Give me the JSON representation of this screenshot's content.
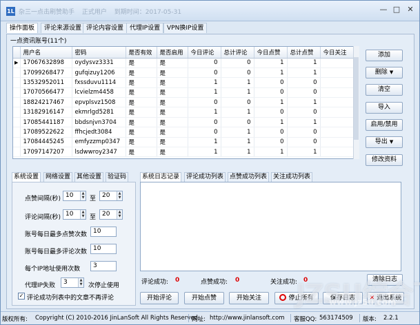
{
  "window": {
    "title_parts": [
      "杂三一点击刷赞助手",
      "正式用户",
      "到期时间：2017-05-31"
    ],
    "app_icon": "1L",
    "controls": {
      "minimize": "—",
      "maximize": "□",
      "close": "✕"
    }
  },
  "menu": {
    "items": [
      {
        "label": "操作面板",
        "active": true
      },
      {
        "label": "评论来源设置"
      },
      {
        "label": "评论内容设置"
      },
      {
        "label": "代理IP设置"
      },
      {
        "label": "VPN换IP设置"
      }
    ]
  },
  "accounts": {
    "group_title": "一点资讯账号(11个)",
    "columns": [
      "用户名",
      "密码",
      "是否有效",
      "是否启用",
      "今日评论",
      "总计评论",
      "今日点赞",
      "总计点赞",
      "今日关注"
    ],
    "rows": [
      [
        "17067632898",
        "oydysvz3331",
        "是",
        "是",
        "0",
        "0",
        "1",
        "1",
        ""
      ],
      [
        "17099268477",
        "gufqizuy1206",
        "是",
        "是",
        "0",
        "0",
        "1",
        "1",
        ""
      ],
      [
        "13532952011",
        "fxssduvu1114",
        "是",
        "是",
        "1",
        "1",
        "0",
        "0",
        ""
      ],
      [
        "17070566477",
        "lcvielzm4458",
        "是",
        "是",
        "1",
        "1",
        "0",
        "0",
        ""
      ],
      [
        "18824217467",
        "epvplsvz1508",
        "是",
        "是",
        "0",
        "0",
        "1",
        "1",
        ""
      ],
      [
        "13182916147",
        "ekmrlgd5281",
        "是",
        "是",
        "1",
        "1",
        "0",
        "0",
        ""
      ],
      [
        "17085441187",
        "bbdsnjvn3704",
        "是",
        "是",
        "0",
        "0",
        "1",
        "1",
        ""
      ],
      [
        "17089522622",
        "ffhcjedt3084",
        "是",
        "是",
        "0",
        "1",
        "0",
        "0",
        ""
      ],
      [
        "17084445245",
        "emfyzzmp0347",
        "是",
        "是",
        "1",
        "1",
        "0",
        "0",
        ""
      ],
      [
        "17097147207",
        "lsdwwroy2347",
        "是",
        "是",
        "1",
        "1",
        "1",
        "1",
        ""
      ]
    ],
    "current_row_marker": "▶"
  },
  "side_buttons": {
    "add": "添加",
    "delete": "删除",
    "clear": "清空",
    "import": "导入",
    "toggle": "启用/禁用",
    "export": "导出",
    "edit": "修改资料"
  },
  "left_tabs": [
    "系统设置",
    "网络设置",
    "其他设置",
    "验证码"
  ],
  "settings": {
    "like_interval_label": "点赞间隔(秒)",
    "like_interval_min": "10",
    "like_interval_max": "20",
    "comment_interval_label": "评论间隔(秒)",
    "comment_interval_min": "10",
    "comment_interval_max": "20",
    "to": "至",
    "max_likes_label": "账号每日最多点赞次数",
    "max_likes": "10",
    "max_comments_label": "账号每日最多评论次数",
    "max_comments": "10",
    "ip_uses_label": "每个IP地址使用次数",
    "ip_uses": "3",
    "proxy_fail_label": "代理IP失败",
    "proxy_fail_value": "3",
    "proxy_fail_suffix": "次停止使用",
    "no_repeat_label": "评论成功列表中的文章不再评论",
    "no_repeat_checked": true
  },
  "right_tabs": [
    "系统日志记录",
    "评论成功列表",
    "点赞成功列表",
    "关注成功列表"
  ],
  "stats": {
    "comment_label": "评论成功:",
    "comment_value": "0",
    "like_label": "点赞成功:",
    "like_value": "0",
    "follow_label": "关注成功:",
    "follow_value": "0",
    "clear_log": "清除日志"
  },
  "actions": {
    "start_comment": "开始评论",
    "start_like": "开始点赞",
    "start_follow": "开始关注",
    "stop_all": "停止所有",
    "save_log": "保存日志",
    "exit": "退出系统"
  },
  "statusbar": {
    "copyright_label": "版权所有:",
    "copyright": "Copyright (C) 2010-2016 JinLanSoft All Rights Reserved.",
    "website_label": "网址:",
    "website": "http://www.jinlansoft.com",
    "qq_label": "客服QQ:",
    "qq": "563174509",
    "version_label": "版本:",
    "version": "2.2.1"
  },
  "watermark": {
    "big": "JZSU综合下载",
    "small": "www.jz5u.com"
  },
  "colors": {
    "accent": "#2f6cc0",
    "stat_value": "#dd0000",
    "border": "#8ea7c6"
  }
}
